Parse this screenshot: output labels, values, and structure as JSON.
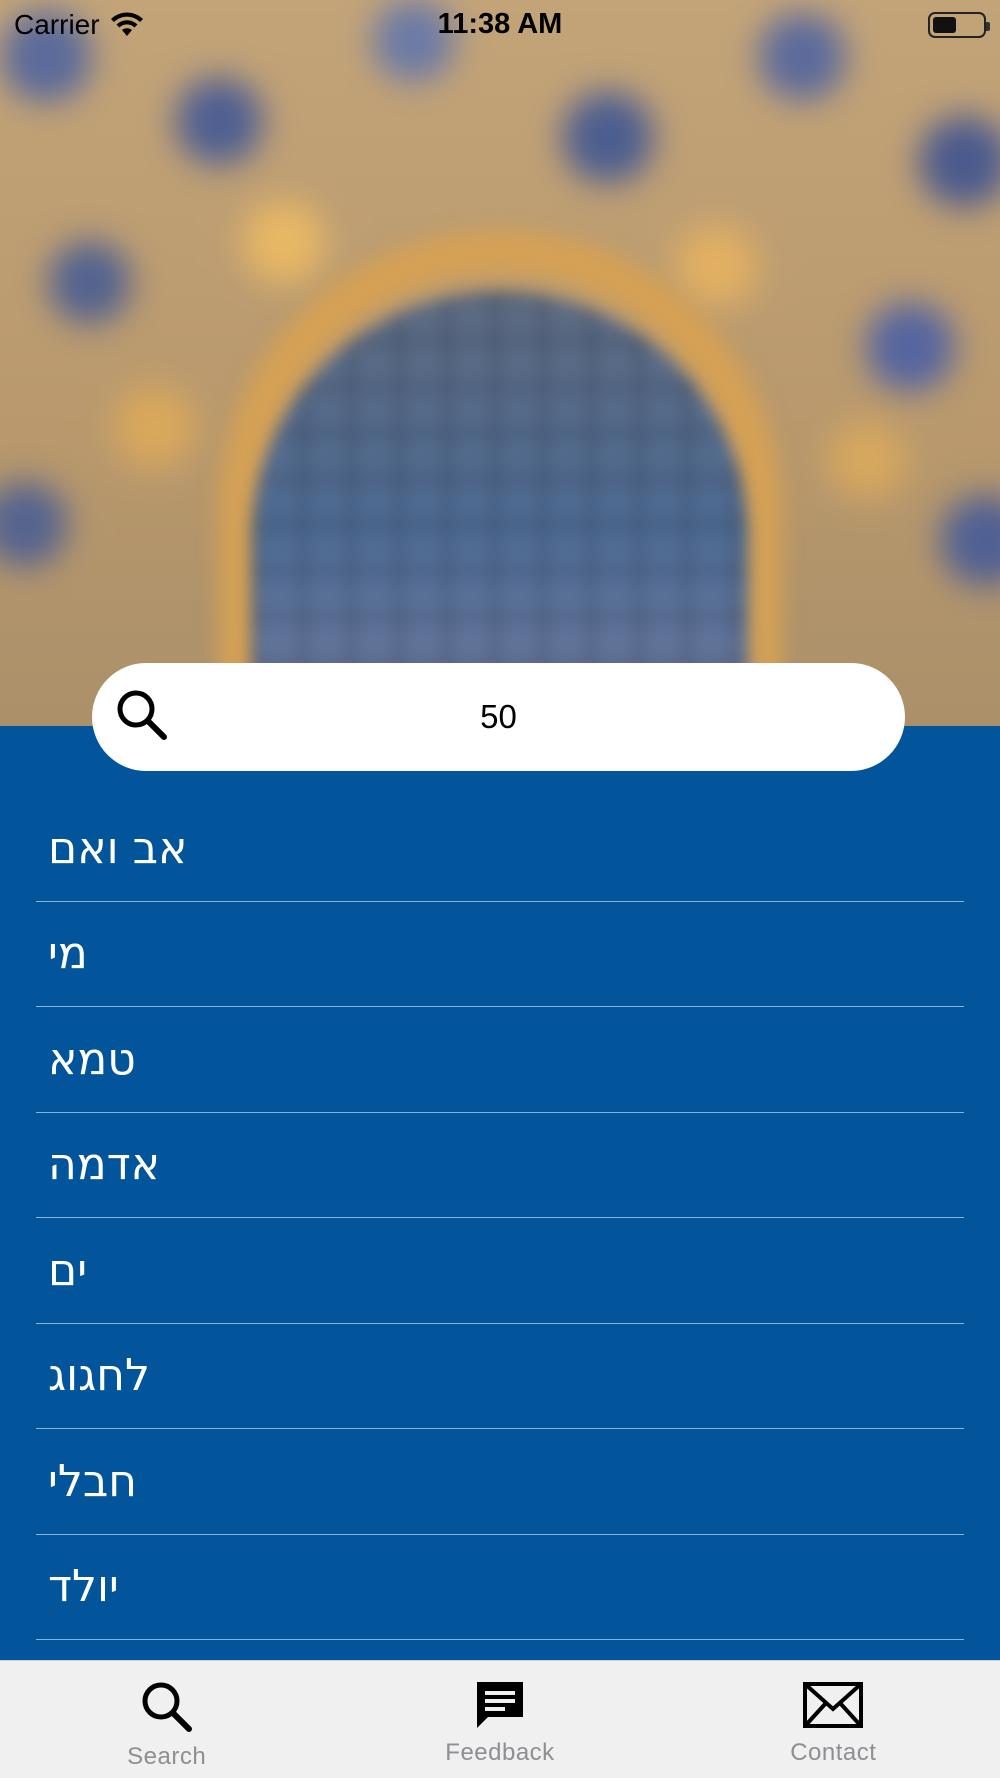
{
  "status_bar": {
    "carrier": "Carrier",
    "time": "11:38 AM",
    "battery_level": 0.48
  },
  "search": {
    "value": "50",
    "icon": "search-icon"
  },
  "results": [
    {
      "label": "אב ואם"
    },
    {
      "label": "מי"
    },
    {
      "label": "טמא"
    },
    {
      "label": "אדמה"
    },
    {
      "label": "ים"
    },
    {
      "label": "לחגוג"
    },
    {
      "label": "חבלי"
    },
    {
      "label": "יולד"
    }
  ],
  "tab_bar": {
    "tabs": [
      {
        "label": "Search",
        "icon": "search-icon"
      },
      {
        "label": "Feedback",
        "icon": "chat-bubble-icon"
      },
      {
        "label": "Contact",
        "icon": "envelope-icon"
      }
    ]
  },
  "colors": {
    "primary_blue": "#02559a",
    "tab_inactive": "#8e8e93",
    "tab_bar_bg": "#f0f0f0"
  }
}
